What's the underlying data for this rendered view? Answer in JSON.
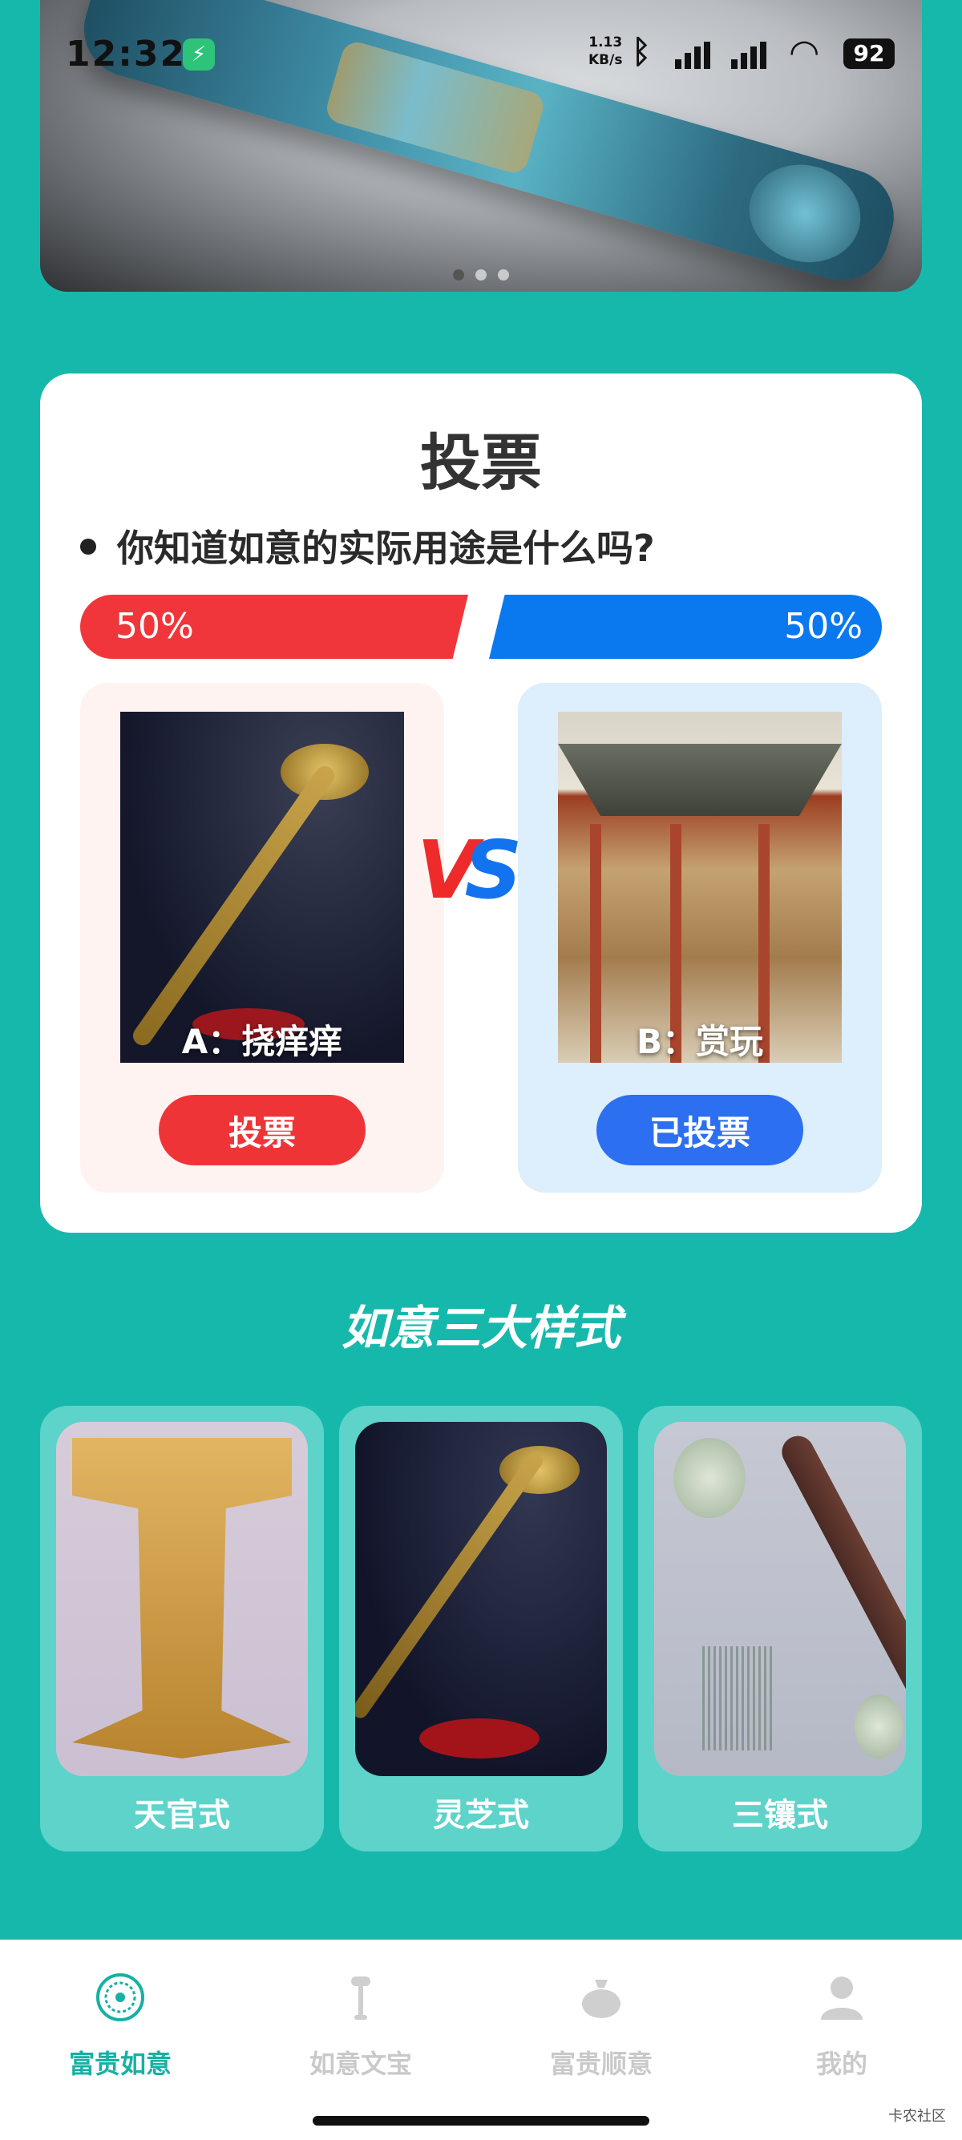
{
  "status_bar": {
    "time": "12:32",
    "net_speed_value": "1.13",
    "net_speed_unit": "KB/s",
    "battery": "92",
    "icons": [
      "charging-icon",
      "bluetooth-icon",
      "signal-icon",
      "signal-icon",
      "wifi-icon",
      "battery-icon"
    ]
  },
  "banner": {
    "dot_count": 3,
    "active_dot": 0
  },
  "vote": {
    "title": "投票",
    "question": "你知道如意的实际用途是什么吗?",
    "option_a": {
      "percent": "50%",
      "label": "A：挠痒痒",
      "button": "投票"
    },
    "option_b": {
      "percent": "50%",
      "label": "B：赏玩",
      "button": "已投票"
    },
    "vs_v": "V",
    "vs_s": "S",
    "colors": {
      "a": "#ef3438",
      "b": "#1373ee"
    }
  },
  "styles": {
    "title": "如意三大样式",
    "items": [
      {
        "label": "天官式"
      },
      {
        "label": "灵芝式"
      },
      {
        "label": "三镶式"
      }
    ]
  },
  "bottom_nav": {
    "items": [
      {
        "label": "富贵如意",
        "icon": "ruyi-emblem-icon",
        "active": true
      },
      {
        "label": "如意文宝",
        "icon": "scepter-icon",
        "active": false
      },
      {
        "label": "富贵顺意",
        "icon": "money-bag-icon",
        "active": false
      },
      {
        "label": "我的",
        "icon": "user-icon",
        "active": false
      }
    ],
    "active_color": "#17b0a4"
  },
  "watermark": "卡农社区"
}
